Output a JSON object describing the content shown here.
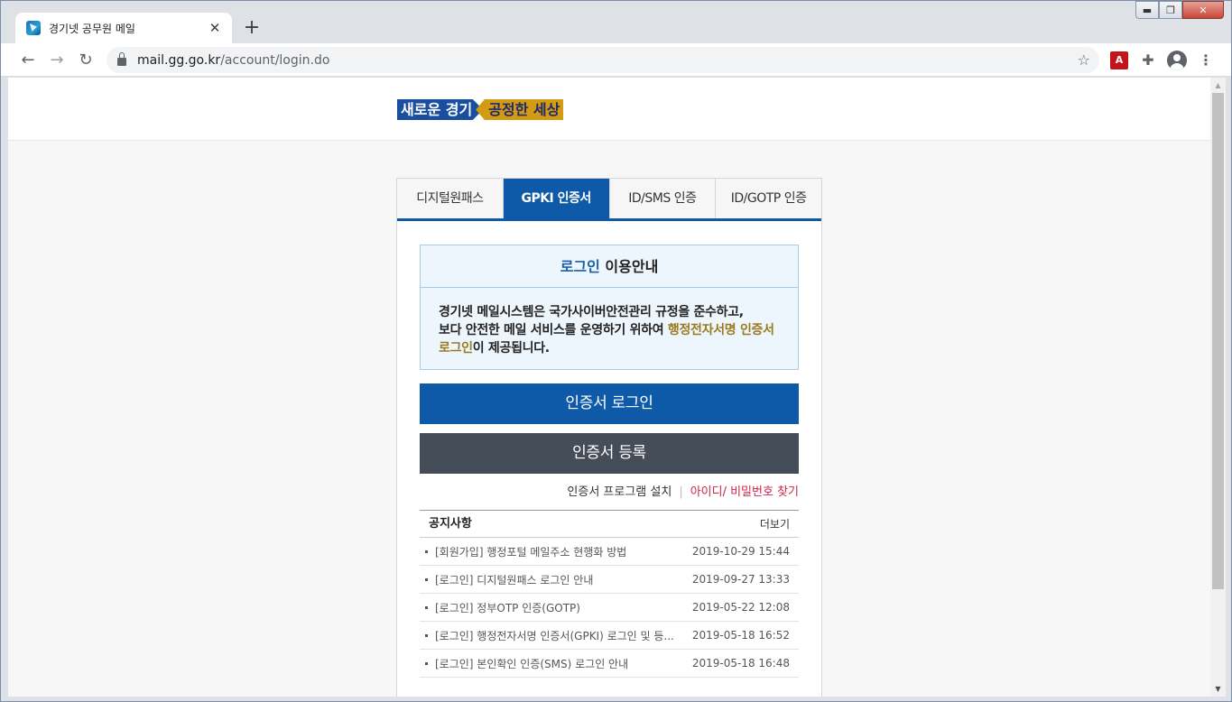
{
  "browser": {
    "tab_title": "경기넷 공무원 메일",
    "url_host": "mail.gg.go.kr",
    "url_path": "/account/login.do"
  },
  "site": {
    "slogan_part1": "새로운 경기",
    "slogan_part2": "공정한 세상"
  },
  "login": {
    "tabs": [
      {
        "label": "디지털원패스",
        "active": false
      },
      {
        "label": "GPKI 인증서",
        "active": true
      },
      {
        "label": "ID/SMS 인증",
        "active": false
      },
      {
        "label": "ID/GOTP 인증",
        "active": false
      }
    ],
    "info": {
      "title_highlight": "로그인",
      "title_rest": " 이용안내",
      "body_line1": "경기넷 메일시스템은 국가사이버안전관리 규정을 준수하고,",
      "body_line2a": "보다 안전한 메일 서비스를 운영하기 위하여 ",
      "body_gold": "행정전자서명 인증서 로그인",
      "body_line2b": "이 제공됩니다."
    },
    "buttons": {
      "cert_login": "인증서 로그인",
      "cert_register": "인증서 등록"
    },
    "links": {
      "install": "인증서 프로그램 설치",
      "find": "아이디/ 비밀번호 찾기"
    },
    "notice": {
      "heading": "공지사항",
      "more": "더보기",
      "items": [
        {
          "title": "[회원가입] 행정포털 메일주소 현행화 방법",
          "date": "2019-10-29 15:44"
        },
        {
          "title": "[로그인] 디지털원패스 로그인 안내",
          "date": "2019-09-27 13:33"
        },
        {
          "title": "[로그인] 정부OTP 인증(GOTP)",
          "date": "2019-05-22 12:08"
        },
        {
          "title": "[로그인] 행정전자서명 인증서(GPKI) 로그인 및 등...",
          "date": "2019-05-18 16:52"
        },
        {
          "title": "[로그인] 본인확인 인증(SMS) 로그인 안내",
          "date": "2019-05-18 16:48"
        }
      ]
    }
  },
  "colors": {
    "primary_blue": "#0e5aa8",
    "dark_button": "#454d58",
    "link_red": "#d0234a",
    "gold_text": "#9a7a1e"
  }
}
